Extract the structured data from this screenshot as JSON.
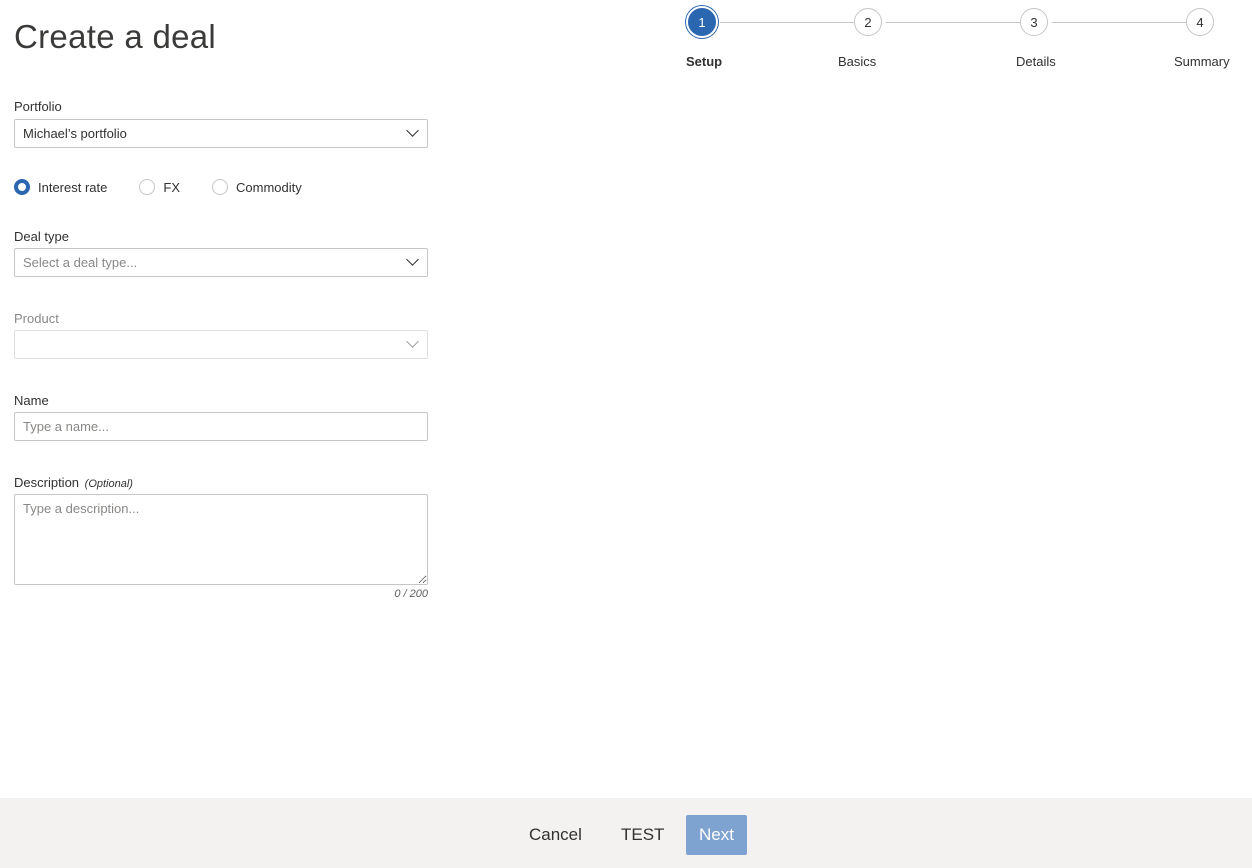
{
  "page": {
    "title": "Create a deal"
  },
  "stepper": {
    "active_step": 1,
    "steps": [
      {
        "number": "1",
        "label": "Setup"
      },
      {
        "number": "2",
        "label": "Basics"
      },
      {
        "number": "3",
        "label": "Details"
      },
      {
        "number": "4",
        "label": "Summary"
      }
    ]
  },
  "form": {
    "portfolio": {
      "label": "Portfolio",
      "value": "Michael’s portfolio"
    },
    "asset_class": {
      "selected": "Interest rate",
      "options": [
        "Interest rate",
        "FX",
        "Commodity"
      ]
    },
    "deal_type": {
      "label": "Deal type",
      "placeholder": "Select a deal type..."
    },
    "product": {
      "label": "Product",
      "value": "",
      "disabled": true
    },
    "name": {
      "label": "Name",
      "placeholder": "Type a name..."
    },
    "description": {
      "label": "Description",
      "optional_tag": "(Optional)",
      "placeholder": "Type a description...",
      "counter": "0 / 200"
    }
  },
  "footer": {
    "cancel_label": "Cancel",
    "test_label": "TEST",
    "next_label": "Next"
  },
  "colors": {
    "accent": "#2b66b1",
    "next_disabled": "#7ea3d1",
    "footer_bg": "#f3f2f1"
  }
}
